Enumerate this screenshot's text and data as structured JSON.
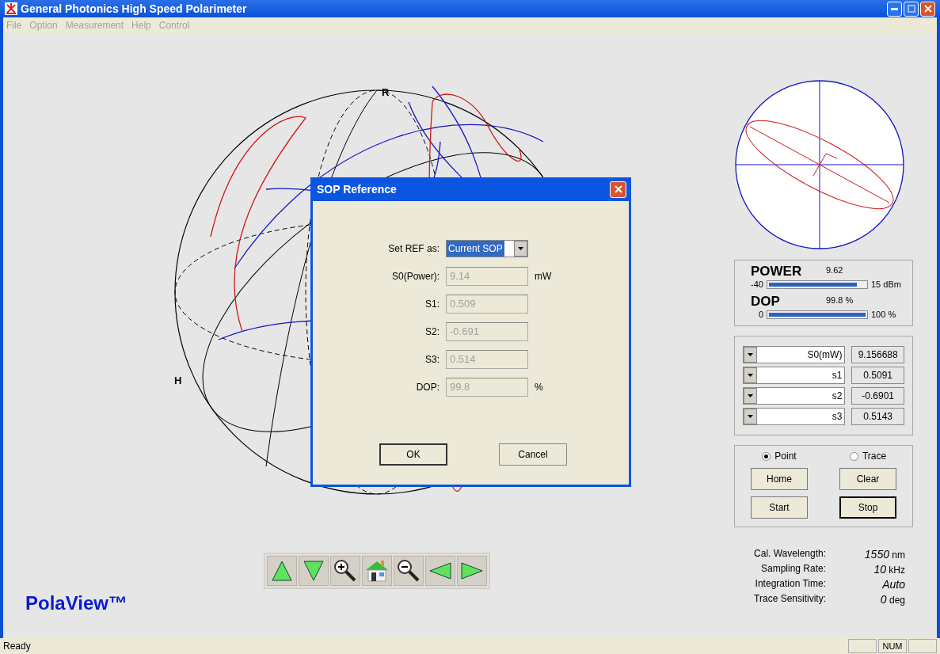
{
  "window": {
    "title": "General Photonics High Speed Polarimeter"
  },
  "menu": [
    {
      "label": "File",
      "disabled": true
    },
    {
      "label": "Option",
      "disabled": true
    },
    {
      "label": "Measurement",
      "disabled": true
    },
    {
      "label": "Help",
      "disabled": true
    },
    {
      "label": "Control",
      "disabled": true
    }
  ],
  "sphere": {
    "labels": [
      "R",
      "H"
    ]
  },
  "toolbar": [
    {
      "kind": "up"
    },
    {
      "kind": "down"
    },
    {
      "kind": "zoom-in"
    },
    {
      "kind": "home"
    },
    {
      "kind": "zoom-out"
    },
    {
      "kind": "left"
    },
    {
      "kind": "right"
    }
  ],
  "logo": "PolaView™",
  "dialog": {
    "title": "SOP Reference",
    "ref_label": "Set REF as:",
    "ref_value": "Current SOP",
    "fields": [
      {
        "label": "S0(Power):",
        "value": "9.14",
        "unit": "mW",
        "disabled": true
      },
      {
        "label": "S1:",
        "value": "0.509",
        "disabled": true
      },
      {
        "label": "S2:",
        "value": "-0.691",
        "disabled": true
      },
      {
        "label": "S3:",
        "value": "0.514",
        "disabled": true
      },
      {
        "label": "DOP:",
        "value": "99.8",
        "unit": "%",
        "disabled": true
      }
    ],
    "buttons": [
      {
        "label": "OK",
        "default": true
      },
      {
        "label": "Cancel",
        "default": false
      }
    ]
  },
  "meters": [
    {
      "label": "POWER",
      "reading": "9.62",
      "min": "-40",
      "max": "15 dBm",
      "level": 0.91
    },
    {
      "label": "DOP",
      "reading": "99.8 %",
      "min": "0",
      "max": "100 %",
      "level": 0.998
    }
  ],
  "stokes": [
    {
      "name": "S0(mW)",
      "value": "9.156688"
    },
    {
      "name": "s1",
      "value": "0.5091"
    },
    {
      "name": "s2",
      "value": "-0.6901"
    },
    {
      "name": "s3",
      "value": "0.5143"
    }
  ],
  "mode": [
    {
      "label": "Point",
      "selected": true
    },
    {
      "label": "Trace",
      "selected": false
    }
  ],
  "buttons": [
    {
      "label": "Home",
      "default": false
    },
    {
      "label": "Clear",
      "default": false
    },
    {
      "label": "Start",
      "default": false
    },
    {
      "label": "Stop",
      "default": true
    }
  ],
  "info": [
    {
      "label": "Cal. Wavelength:",
      "value": "1550",
      "unit": "nm"
    },
    {
      "label": "Sampling Rate:",
      "value": "10",
      "unit": "kHz"
    },
    {
      "label": "Integration Time:",
      "value": "Auto"
    },
    {
      "label": "Trace Sensitivity:",
      "value": "0",
      "unit": "deg"
    }
  ],
  "status_bar": {
    "text": "Ready",
    "indicators": [
      "NUM"
    ]
  }
}
